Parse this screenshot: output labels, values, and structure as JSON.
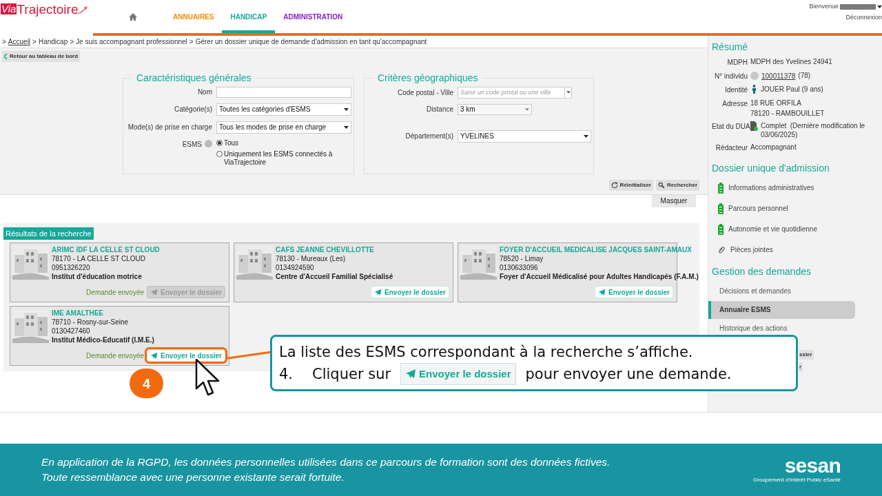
{
  "header": {
    "logo": {
      "part1": "Via",
      "part2": "Trajectoire"
    },
    "nav": [
      {
        "label": "ANNUAIRES",
        "color": "#f28c00",
        "selected": false
      },
      {
        "label": "HANDICAP",
        "color": "#14a99a",
        "selected": true
      },
      {
        "label": "ADMINISTRATION",
        "color": "#8a1fc4",
        "selected": false
      }
    ],
    "user": {
      "greeting": "Bienvenue",
      "logout": "Déconnexion"
    }
  },
  "breadcrumb": {
    "separator": ">",
    "items": [
      {
        "label": "Accueil",
        "link": true
      },
      {
        "label": "Handicap",
        "link": false
      },
      {
        "label": "Je suis accompagnant professionnel",
        "link": false
      },
      {
        "label": "Gérer un dossier unique de demande d'admission en tant qu'accompagnant",
        "link": false
      }
    ]
  },
  "back_button": "Retour au tableau de bord",
  "filters": [
    {
      "title": "Caractéristiques générales",
      "fields": [
        {
          "kind": "text",
          "label": "Nom"
        },
        {
          "kind": "select",
          "label": "Catégorie(s)",
          "value": "Toutes les catégories d'ESMS"
        },
        {
          "kind": "select",
          "label": "Mode(s) de prise en charge",
          "value": "Tous les modes de prise en charge"
        },
        {
          "kind": "radio",
          "label": "ESMS",
          "info": true,
          "options": [
            {
              "label": "Tous",
              "selected": true
            },
            {
              "label": "Uniquement les ESMS connectés à ViaTrajectoire",
              "selected": false
            }
          ]
        }
      ]
    },
    {
      "title": "Critères géographiques",
      "fields": [
        {
          "kind": "combo",
          "label": "Code postal - Ville",
          "placeholder": "Saisir un code postal ou une ville"
        },
        {
          "kind": "small-select",
          "label": "Distance",
          "value": "3 km"
        },
        {
          "kind": "select",
          "label": "Département(s)",
          "value": "YVELINES"
        }
      ]
    }
  ],
  "actions": [
    {
      "label": "Réinitialiser",
      "kind": "reset"
    },
    {
      "label": "Rechercher",
      "kind": "search"
    }
  ],
  "hide_button": "Masquer",
  "results": {
    "title": "Résultats de la recherche",
    "cards": [
      {
        "name": "ARIMC IDF LA CELLE ST CLOUD",
        "city": "78170 - LA CELLE ST CLOUD",
        "phone": "0951326220",
        "type": "Institut d'éducation motrice",
        "status": "Demande envoyée",
        "button": "Envoyer le dossier",
        "disabled": true,
        "highlighted": false
      },
      {
        "name": "CAFS JEANNE CHEVILLOTTE",
        "city": "78130 - Mureaux (Les)",
        "phone": "0134924590",
        "type": "Centre d'Accueil Familial Spécialisé",
        "button": "Envoyer le dossier",
        "disabled": false,
        "highlighted": false
      },
      {
        "name": "FOYER D'ACCUEIL MEDICALISE JACQUES SAINT-AMAUX",
        "city": "78520 - Limay",
        "phone": "0130633096",
        "type": "Foyer d'Accueil Médicalisé pour Adultes Handicapés (F.A.M.)",
        "button": "Envoyer le dossier",
        "disabled": false,
        "highlighted": false
      },
      {
        "name": "IME AMALTHEE",
        "city": "78710 - Rosny-sur-Seine",
        "phone": "0130427460",
        "type": "Institut Médico-Educatif (I.M.E.)",
        "status": "Demande envoyée",
        "button": "Envoyer le dossier",
        "disabled": false,
        "highlighted": true
      }
    ]
  },
  "sidebar": {
    "summary_title": "Résumé",
    "summary": [
      {
        "kind": "text",
        "label": "MDPH",
        "lines": [
          "MDPH des Yvelines 24941"
        ]
      },
      {
        "kind": "individual",
        "label": "N° individu",
        "link": "100011378",
        "lines": [
          "(78)"
        ]
      },
      {
        "kind": "person",
        "label": "Identité",
        "lines": [
          "JOUER Paul (9 ans)"
        ]
      },
      {
        "kind": "text",
        "label": "Adresse",
        "lines": [
          "18 RUE ORFILA",
          "78120 - RAMBOUILLET"
        ]
      },
      {
        "kind": "document",
        "label": "Etat du DUA",
        "lines": [
          "Complet  (Dernière modification le 03/06/2025)"
        ]
      },
      {
        "kind": "text",
        "label": "Rédacteur",
        "lines": [
          "Accompagnant"
        ]
      }
    ],
    "dossier_title": "Dossier unique d'admission",
    "dossier": [
      {
        "kind": "complete",
        "label": "Informations administratives"
      },
      {
        "kind": "complete",
        "label": "Parcours personnel"
      },
      {
        "kind": "complete",
        "label": "Autonomie et vie quotidienne"
      },
      {
        "kind": "attachment",
        "label": "Pièces jointes"
      }
    ],
    "requests_title": "Gestion des demandes",
    "requests": [
      {
        "label": "Décisions et demandes",
        "selected": false
      },
      {
        "label": "Annuaire ESMS",
        "selected": true
      },
      {
        "label": "Historique des actions",
        "selected": false
      }
    ],
    "hidden_buttons": [
      "ssier",
      "r"
    ]
  },
  "callout": {
    "line1": "La liste des ESMS correspondant à la recherche s’affiche.",
    "number": "4.",
    "before": "Cliquer sur",
    "button": "Envoyer le dossier",
    "after": "pour envoyer une demande.",
    "step": "4"
  },
  "footer": {
    "lines": [
      "En application de la RGPD, les données personnelles utilisées dans ce parcours de formation sont des données fictives.",
      "Toute ressemblance avec une personne existante serait fortuite."
    ],
    "logo": "sesan",
    "logo_caption": "Groupement d'Intérêt Public eSanté"
  }
}
